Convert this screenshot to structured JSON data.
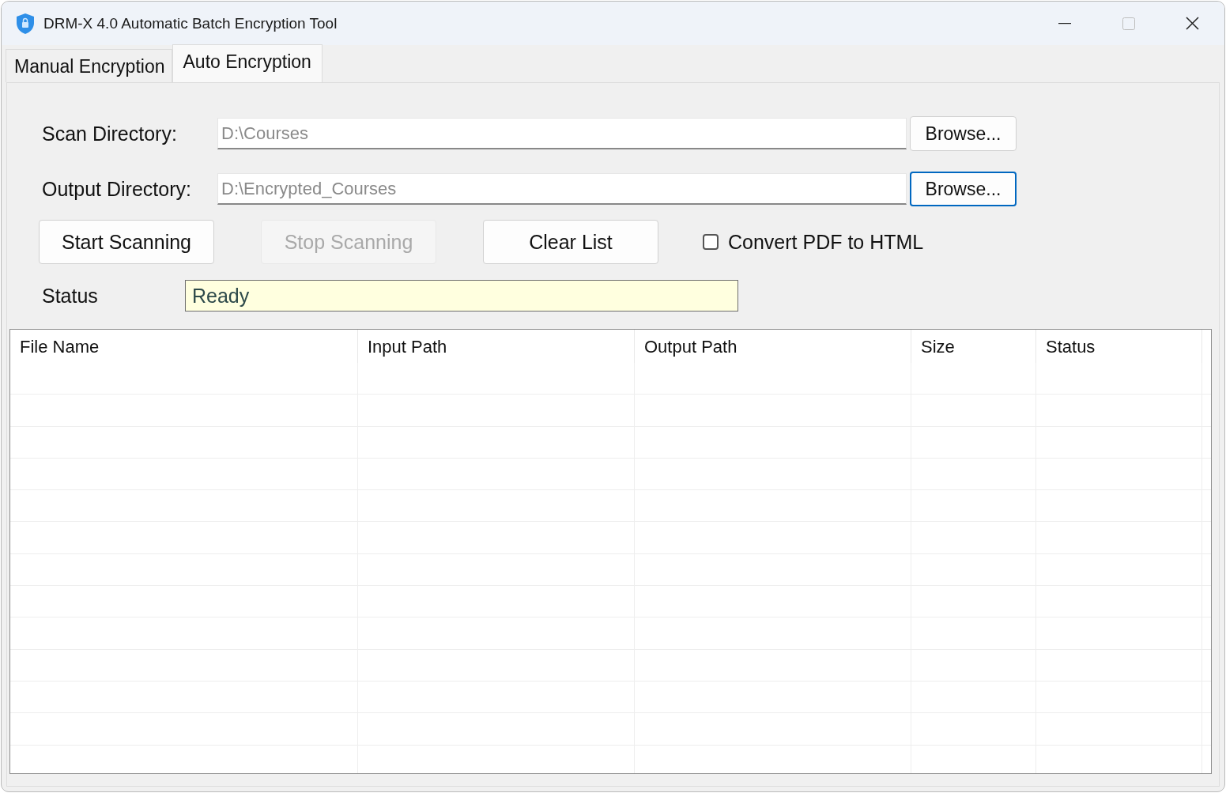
{
  "window": {
    "title": "DRM-X 4.0 Automatic Batch Encryption Tool"
  },
  "tabs": [
    {
      "label": "Manual Encryption",
      "selected": false
    },
    {
      "label": "Auto Encryption",
      "selected": true
    }
  ],
  "directories": [
    {
      "label": "Scan Directory:",
      "value": "D:\\Courses",
      "button": "Browse...",
      "focused": false
    },
    {
      "label": "Output Directory:",
      "value": "D:\\Encrypted_Courses",
      "button": "Browse...",
      "focused": true
    }
  ],
  "actions": [
    {
      "label": "Start Scanning",
      "disabled": false
    },
    {
      "label": "Stop Scanning",
      "disabled": true
    },
    {
      "label": "Clear List",
      "disabled": false
    }
  ],
  "convert_option": {
    "label": "Convert PDF to HTML",
    "checked": false
  },
  "status": {
    "label": "Status",
    "value": "Ready"
  },
  "table": {
    "columns": [
      "File Name",
      "Input Path",
      "Output Path",
      "Size",
      "Status"
    ]
  }
}
